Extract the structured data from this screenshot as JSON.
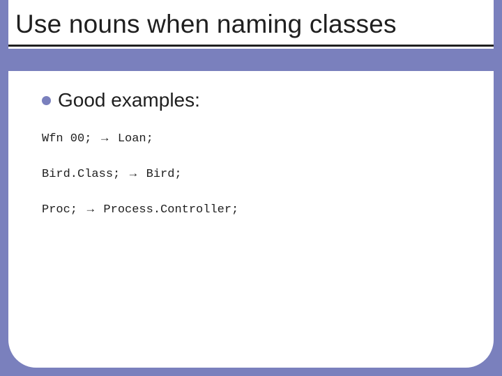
{
  "slide": {
    "title": "Use nouns when naming classes",
    "bullet": "Good examples:",
    "examples": [
      {
        "from": "Wfn 00;",
        "to": "Loan;"
      },
      {
        "from": "Bird.Class;",
        "to": "Bird;"
      },
      {
        "from": "Proc;",
        "to": "Process.Controller;"
      }
    ],
    "arrow": "→"
  }
}
